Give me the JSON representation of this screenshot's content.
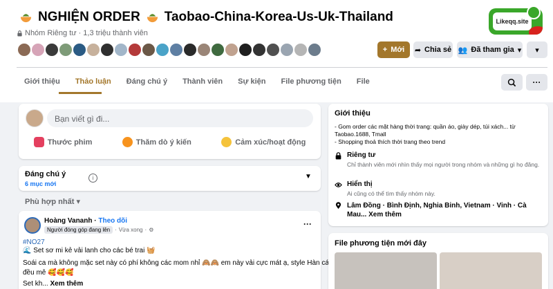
{
  "group": {
    "title": "NGHIỆN ORDER",
    "title_suffix": "Taobao-China-Korea-Us-Uk-Thailand",
    "privacy": "Nhóm Riêng tư",
    "members": "1,3 triệu thành viên",
    "logo_text": "Likeqq.site"
  },
  "member_avatars": [
    "#8b6a55",
    "#d6a4b7",
    "#3a3a3a",
    "#7e9b78",
    "#2b5b84",
    "#c7b19c",
    "#2f2f2f",
    "#a2b6c9",
    "#b43a3a",
    "#6b5847",
    "#4aa3c8",
    "#5e7fa3",
    "#2a2a2a",
    "#9a8577",
    "#3f6a3f",
    "#c0a28f",
    "#1f1f1f",
    "#333333",
    "#505050",
    "#9aa5b1",
    "#b5b5b5",
    "#6c7c8c"
  ],
  "actions": {
    "new_label": "Mới",
    "share_label": "Chia sẻ",
    "joined_label": "Đã tham gia"
  },
  "tabs": [
    "Giới thiệu",
    "Thảo luận",
    "Đáng chú ý",
    "Thành viên",
    "Sự kiện",
    "File phương tiện",
    "File"
  ],
  "composer": {
    "placeholder": "Bạn viết gì đi...",
    "reel_label": "Thước phim",
    "poll_label": "Thăm dò ý kiến",
    "feeling_label": "Cảm xúc/hoạt động"
  },
  "featured": {
    "title": "Đáng chú ý",
    "count": "6 mục mới"
  },
  "sort_label": "Phù hợp nhất",
  "post": {
    "author": "Hoàng Vananh",
    "follow": "Theo dõi",
    "badge": "Người đóng góp đang lên",
    "time": "Vừa xong",
    "tag": "#NO27",
    "line1": "Set sơ mi kẻ vải lanh cho các bé trai",
    "line2": "Soái ca mà không mặc set này có phí không các mom nhỉ 🙈🙈 em này vải cực mát ạ, style Hàn các mẹ",
    "line3": "đều mê 🥰🥰🥰",
    "line4": "Set kh...",
    "more": "Xem thêm"
  },
  "about": {
    "title": "Giới thiệu",
    "desc": "- Gom order các mặt hàng thời trang: quần áo, giày dép, túi xách... từ Taobao.1688, Tmall\n- Shopping thoả thích thời trang theo trend",
    "private_title": "Riêng tư",
    "private_desc": "Chỉ thành viên mới nhìn thấy mọi người trong nhóm và những gì họ đăng.",
    "visible_title": "Hiển thị",
    "visible_desc": "Ai cũng có thể tìm thấy nhóm này.",
    "location": "Lâm Đồng · Bình Định, Nghia Binh, Vietnam · Vinh · Cà Mau...",
    "location_more": "Xem thêm"
  },
  "media": {
    "title": "File phương tiện mới đây"
  },
  "colors": {
    "accent": "#a3772b",
    "link": "#1877f2"
  }
}
